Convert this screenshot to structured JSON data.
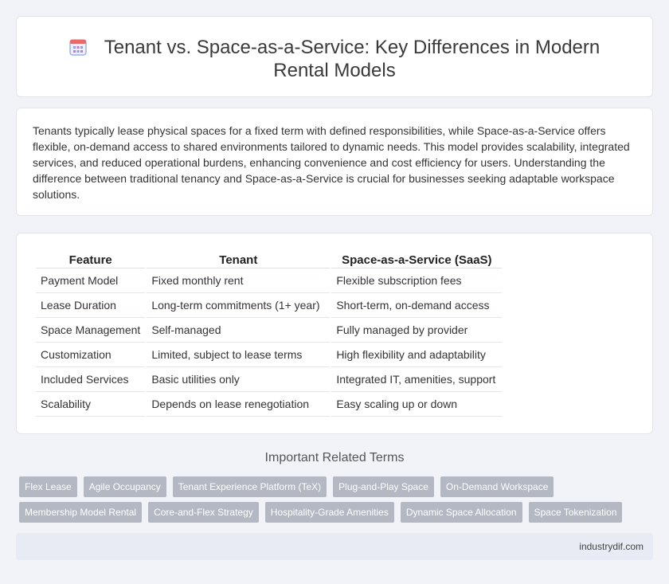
{
  "header": {
    "icon": "calendar-grid-icon",
    "title": "Tenant vs. Space-as-a-Service: Key Differences in Modern Rental Models"
  },
  "intro": "Tenants typically lease physical spaces for a fixed term with defined responsibilities, while Space-as-a-Service offers flexible, on-demand access to shared environments tailored to dynamic needs. This model provides scalability, integrated services, and reduced operational burdens, enhancing convenience and cost efficiency for users. Understanding the difference between traditional tenancy and Space-as-a-Service is crucial for businesses seeking adaptable workspace solutions.",
  "table": {
    "headers": [
      "Feature",
      "Tenant",
      "Space-as-a-Service (SaaS)"
    ],
    "rows": [
      [
        "Payment Model",
        "Fixed monthly rent",
        "Flexible subscription fees"
      ],
      [
        "Lease Duration",
        "Long-term commitments (1+ year)",
        "Short-term, on-demand access"
      ],
      [
        "Space Management",
        "Self-managed",
        "Fully managed by provider"
      ],
      [
        "Customization",
        "Limited, subject to lease terms",
        "High flexibility and adaptability"
      ],
      [
        "Included Services",
        "Basic utilities only",
        "Integrated IT, amenities, support"
      ],
      [
        "Scalability",
        "Depends on lease renegotiation",
        "Easy scaling up or down"
      ]
    ]
  },
  "related": {
    "title": "Important Related Terms",
    "tags": [
      "Flex Lease",
      "Agile Occupancy",
      "Tenant Experience Platform (TeX)",
      "Plug-and-Play Space",
      "On-Demand Workspace",
      "Membership Model Rental",
      "Core-and-Flex Strategy",
      "Hospitality-Grade Amenities",
      "Dynamic Space Allocation",
      "Space Tokenization"
    ]
  },
  "footer": {
    "site": "industrydif.com"
  },
  "colors": {
    "accent": "#5b7fd6",
    "tag_bg": "#b3b8c2",
    "page_bg": "#f1f3f8"
  }
}
